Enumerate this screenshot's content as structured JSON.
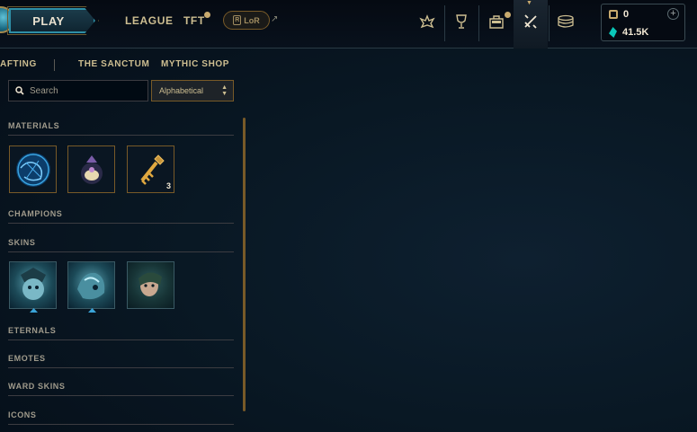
{
  "topbar": {
    "play_label": "PLAY",
    "nav": [
      "LEAGUE",
      "TFT"
    ],
    "lor_label": "LoR",
    "icons": [
      "home-icon",
      "trophy-icon",
      "store-icon",
      "loot-icon",
      "collection-icon"
    ]
  },
  "currency": {
    "rp": "0",
    "blue_essence": "41.5K"
  },
  "subnav": {
    "items": [
      "AFTING",
      "THE SANCTUM",
      "MYTHIC SHOP"
    ]
  },
  "search": {
    "placeholder": "Search"
  },
  "sort": {
    "selected": "Alphabetical"
  },
  "sections": {
    "materials": "MATERIALS",
    "champions": "CHAMPIONS",
    "skins": "SKINS",
    "eternals": "ETERNALS",
    "emotes": "EMOTES",
    "ward_skins": "WARD SKINS",
    "icons": "ICONS"
  },
  "materials": [
    {
      "name": "orb-item",
      "count": ""
    },
    {
      "name": "mythic-item",
      "count": ""
    },
    {
      "name": "key-item",
      "count": "3"
    }
  ],
  "skins": [
    {
      "name": "skin-shard-1"
    },
    {
      "name": "skin-shard-2"
    },
    {
      "name": "skin-shard-3"
    }
  ],
  "colors": {
    "gold": "#c8aa6e",
    "teal": "#0ac8b9",
    "background": "#091824"
  }
}
